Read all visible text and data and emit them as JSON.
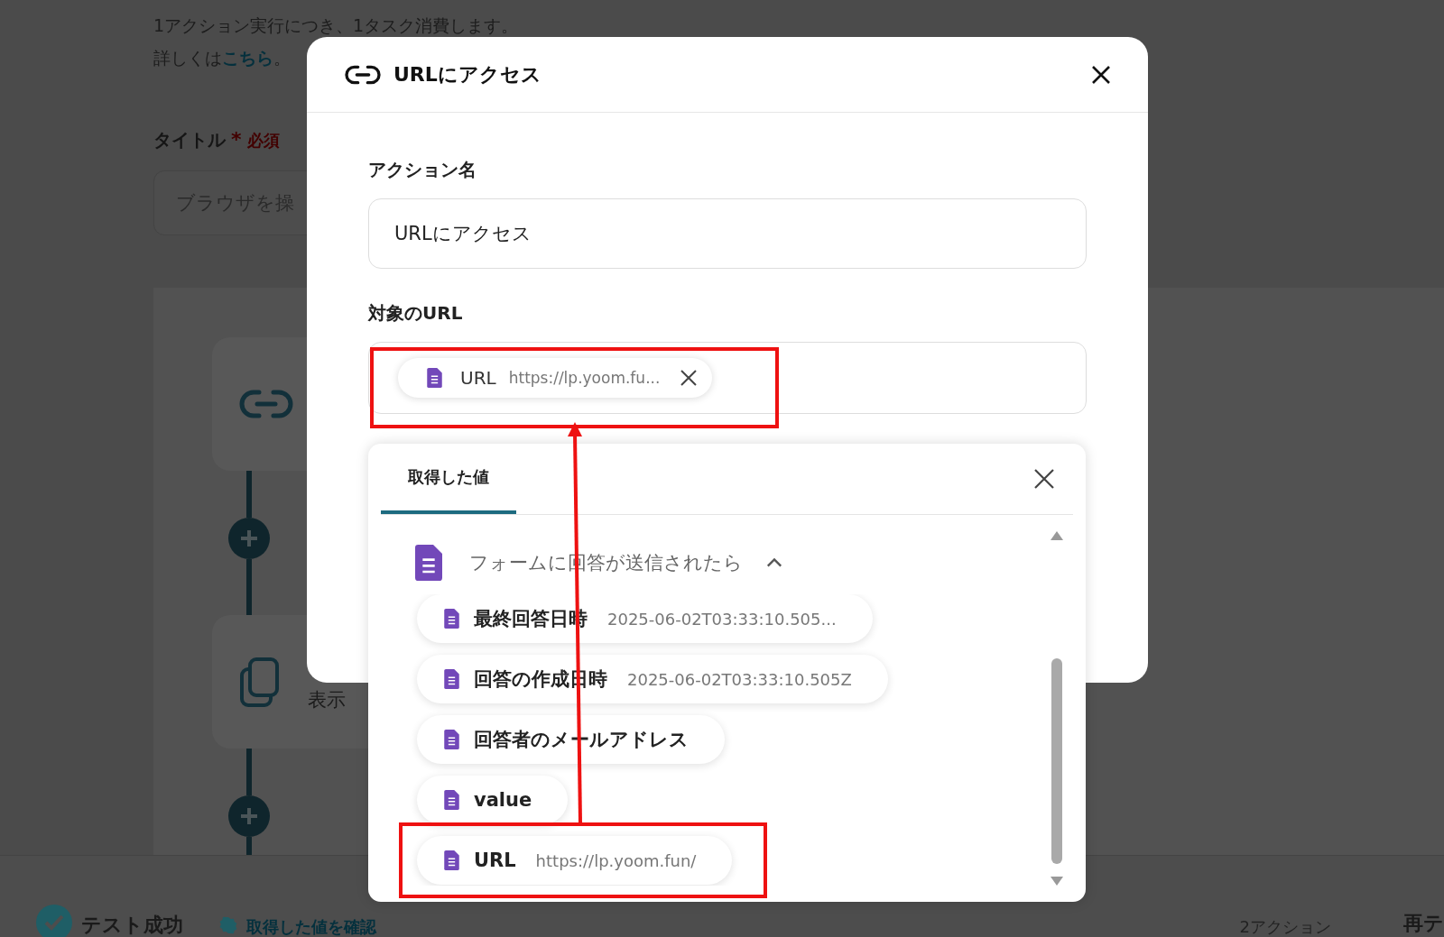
{
  "background_page": {
    "description": "1アクション実行につき、1タスク消費します。",
    "detail_prefix": "詳しくは",
    "detail_link": "こちら",
    "detail_suffix": "。",
    "title_field": {
      "label": "タイトル",
      "required_mark": "*",
      "required_label": "必須",
      "placeholder": "ブラウザを操"
    },
    "flow_steps": [
      {
        "kind": "link"
      },
      {
        "kind": "copy",
        "label": "表示"
      }
    ],
    "footer": {
      "status": "テスト成功",
      "link": "取得した値を確認",
      "action_count": "2アクション",
      "retest_button": "再テ"
    }
  },
  "dialog": {
    "title": "URLにアクセス",
    "action_name": {
      "label": "アクション名",
      "value": "URLにアクセス"
    },
    "target_url": {
      "label": "対象のURL",
      "chip": {
        "name": "URL",
        "value": "https://lp.yoom.fu..."
      }
    }
  },
  "value_picker": {
    "tabs": [
      {
        "label": "取得した値",
        "selected": true
      }
    ],
    "group": {
      "title": "フォームに回答が送信されたら",
      "expanded": true,
      "items": [
        {
          "name": "最終回答日時",
          "value": "2025-06-02T03:33:10.505..."
        },
        {
          "name": "回答の作成日時",
          "value": "2025-06-02T03:33:10.505Z"
        },
        {
          "name": "回答者のメールアドレス"
        },
        {
          "name": "value"
        },
        {
          "name": "URL",
          "value": "https://lp.yoom.fun/"
        }
      ]
    }
  }
}
